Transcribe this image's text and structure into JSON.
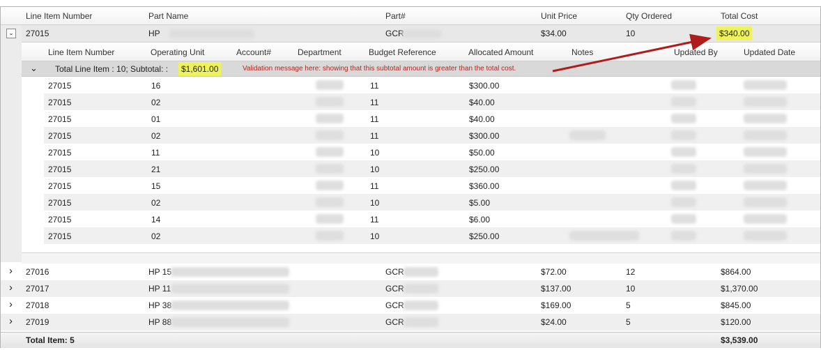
{
  "headers": {
    "line_item_number": "Line Item Number",
    "part_name": "Part Name",
    "part_no": "Part#",
    "unit_price": "Unit Price",
    "qty_ordered": "Qty Ordered",
    "total_cost": "Total Cost"
  },
  "main_row": {
    "expand_icon": "⌄",
    "line": "27015",
    "part_name": "HP",
    "part_no": "GCR",
    "unit_price": "$34.00",
    "qty": "10",
    "total": "$340.00"
  },
  "detail_headers": {
    "line_item_number": "Line Item Number",
    "operating_unit": "Operating Unit",
    "account": "Account#",
    "department": "Department",
    "budget_reference": "Budget Reference",
    "allocated_amount": "Allocated Amount",
    "notes": "Notes",
    "updated_by": "Updated By",
    "updated_date": "Updated Date"
  },
  "group_row": {
    "collapse_icon": "⌄",
    "label": "Total Line Item : 10; Subtotal: :",
    "subtotal": "$1,601.00",
    "validation_message": "Validation message here: showing that this subtotal amount is greater than the total cost."
  },
  "detail_rows": [
    {
      "line": "27015",
      "unit": "16",
      "budget": "11",
      "amount": "$300.00"
    },
    {
      "line": "27015",
      "unit": "02",
      "budget": "11",
      "amount": "$40.00"
    },
    {
      "line": "27015",
      "unit": "01",
      "budget": "11",
      "amount": "$40.00"
    },
    {
      "line": "27015",
      "unit": "02",
      "budget": "11",
      "amount": "$300.00"
    },
    {
      "line": "27015",
      "unit": "11",
      "budget": "10",
      "amount": "$50.00"
    },
    {
      "line": "27015",
      "unit": "21",
      "budget": "10",
      "amount": "$250.00"
    },
    {
      "line": "27015",
      "unit": "15",
      "budget": "11",
      "amount": "$360.00"
    },
    {
      "line": "27015",
      "unit": "02",
      "budget": "10",
      "amount": "$5.00"
    },
    {
      "line": "27015",
      "unit": "14",
      "budget": "11",
      "amount": "$6.00"
    },
    {
      "line": "27015",
      "unit": "02",
      "budget": "10",
      "amount": "$250.00"
    }
  ],
  "other_rows": [
    {
      "chevron": "›",
      "line": "27016",
      "part_name": "HP 15",
      "part_no": "GCR",
      "unit_price": "$72.00",
      "qty": "12",
      "total": "$864.00"
    },
    {
      "chevron": "›",
      "line": "27017",
      "part_name": "HP 11",
      "part_no": "GCR",
      "unit_price": "$137.00",
      "qty": "10",
      "total": "$1,370.00"
    },
    {
      "chevron": "›",
      "line": "27018",
      "part_name": "HP 38",
      "part_no": "GCR",
      "unit_price": "$169.00",
      "qty": "5",
      "total": "$845.00"
    },
    {
      "chevron": "›",
      "line": "27019",
      "part_name": "HP 88",
      "part_no": "GCR",
      "unit_price": "$24.00",
      "qty": "5",
      "total": "$120.00"
    }
  ],
  "footer": {
    "total_items": "Total Item: 5",
    "grand_total": "$3,539.00"
  },
  "colors": {
    "highlight": "#eef25c",
    "validation_text": "#b3261e",
    "arrow": "#b01c1c"
  }
}
